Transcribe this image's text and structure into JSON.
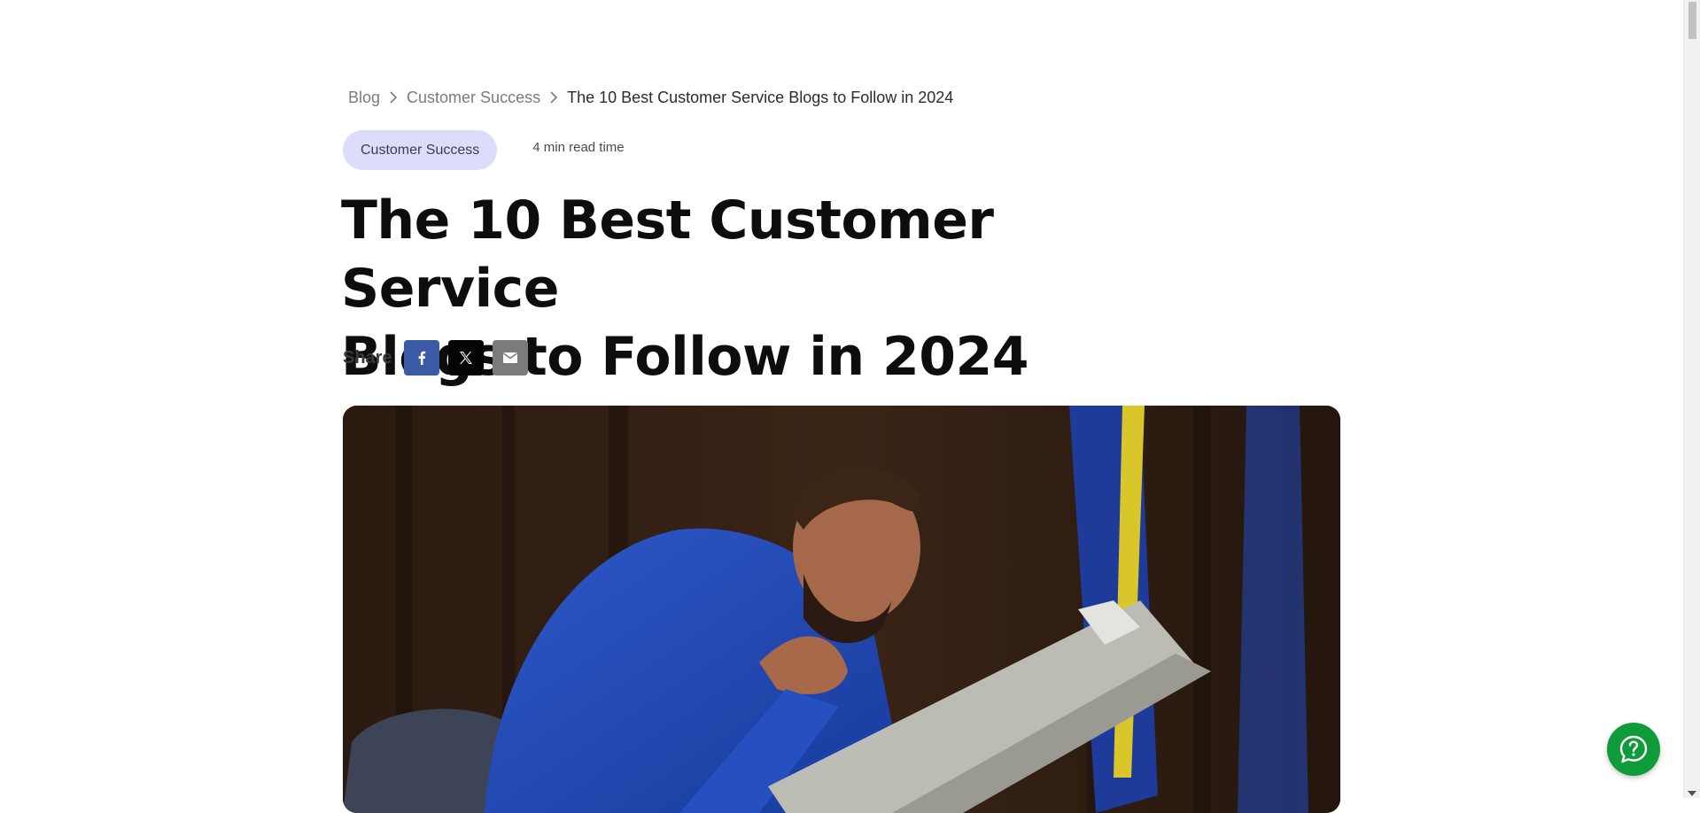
{
  "breadcrumb": {
    "items": [
      {
        "label": "Blog"
      },
      {
        "label": "Customer Success"
      },
      {
        "label": "The 10 Best Customer Service Blogs to Follow in 2024"
      }
    ]
  },
  "meta": {
    "category_tag": "Customer Success",
    "read_time": "4 min read time"
  },
  "article": {
    "title_line1": "The 10 Best Customer Service",
    "title_line2": "Blogs to Follow in 2024"
  },
  "share": {
    "label": "Share",
    "buttons": [
      {
        "icon": "facebook-icon",
        "color": "#3b5ba6"
      },
      {
        "icon": "x-icon",
        "color": "#050505"
      },
      {
        "icon": "email-icon",
        "color": "#7b7b7b"
      }
    ]
  },
  "hero": {
    "icon": "hero-image"
  },
  "help_widget": {
    "icon": "question-icon",
    "color": "#109b3b"
  },
  "colors": {
    "tag_background": "#dcdcfb",
    "title_text": "#0d0d0d"
  }
}
